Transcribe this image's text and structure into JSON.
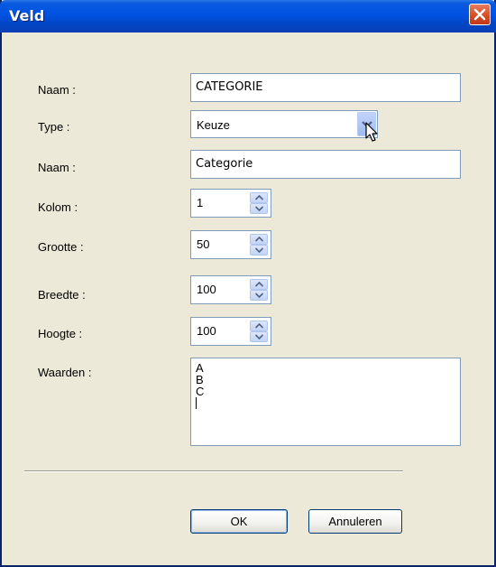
{
  "window": {
    "title": "Veld"
  },
  "fields": {
    "naam1": {
      "label": "Naam :",
      "value": "CATEGORIE"
    },
    "type": {
      "label": "Type :",
      "value": "Keuze"
    },
    "naam2": {
      "label": "Naam :",
      "value": "Categorie"
    },
    "kolom": {
      "label": "Kolom :",
      "value": "1"
    },
    "grootte": {
      "label": "Grootte :",
      "value": "50"
    },
    "breedte": {
      "label": "Breedte :",
      "value": "100"
    },
    "hoogte": {
      "label": "Hoogte :",
      "value": "100"
    },
    "waarden": {
      "label": "Waarden :",
      "lines": [
        "A",
        "B",
        "C"
      ]
    }
  },
  "buttons": {
    "ok": "OK",
    "cancel": "Annuleren"
  },
  "icons": {
    "close": "close-icon",
    "dropdown": "chevron-down-icon",
    "spin_up": "arrow-up-icon",
    "spin_down": "arrow-down-icon",
    "cursor": "mouse-pointer-icon"
  },
  "colors": {
    "titlebar": "#0053e2",
    "close": "#d44b24",
    "window_bg": "#ece9d8",
    "field_border": "#7f9db9"
  }
}
